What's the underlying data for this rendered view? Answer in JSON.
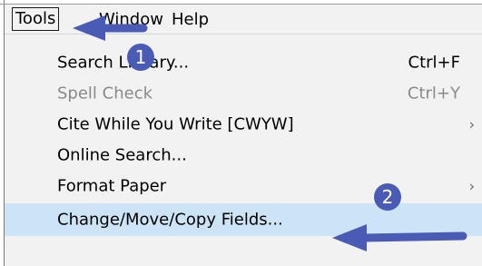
{
  "menubar": {
    "tools_label": "Tools",
    "window_label": "Window",
    "help_label": "Help"
  },
  "menu": {
    "items": [
      {
        "label": "Search Library...",
        "shortcut": "Ctrl+F",
        "enabled": true,
        "submenu": false
      },
      {
        "label": "Spell Check",
        "shortcut": "Ctrl+Y",
        "enabled": false,
        "submenu": false
      },
      {
        "label": "Cite While You Write [CWYW]",
        "shortcut": "",
        "enabled": true,
        "submenu": true
      },
      {
        "label": "Online Search...",
        "shortcut": "",
        "enabled": true,
        "submenu": false
      },
      {
        "label": "Format Paper",
        "shortcut": "",
        "enabled": true,
        "submenu": true
      },
      {
        "label": "Change/Move/Copy Fields...",
        "shortcut": "",
        "enabled": true,
        "submenu": false,
        "highlighted": true
      }
    ]
  },
  "annotations": {
    "badge1": "1",
    "badge2": "2",
    "arrow_color": "#4a5bb5",
    "highlight_color": "#cde4f7"
  },
  "icons": {
    "submenu": "chevron-right-icon"
  }
}
